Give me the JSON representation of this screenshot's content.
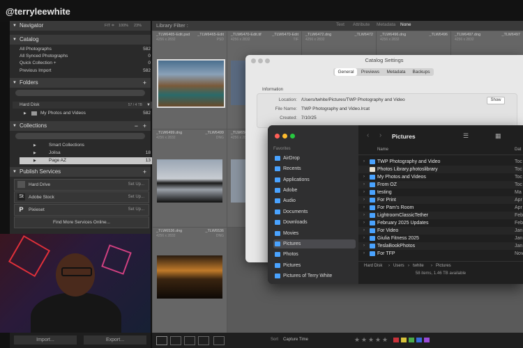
{
  "overlay": {
    "handle": "@terryleewhite"
  },
  "left_panel": {
    "navigator": {
      "label": "Navigator",
      "zoom": [
        "FIT ≑",
        "100%",
        "23%"
      ]
    },
    "catalog": {
      "label": "Catalog",
      "items": [
        {
          "label": "All Photographs",
          "count": "582"
        },
        {
          "label": "All Synced Photographs",
          "count": "0"
        },
        {
          "label": "Quick Collection +",
          "count": "0"
        },
        {
          "label": "Previous Import",
          "count": "582"
        }
      ]
    },
    "folders": {
      "label": "Folders",
      "disk": "Hard Disk",
      "disk_usage": "57 / 4 TB",
      "items": [
        {
          "label": "My Photos and Videos",
          "count": "582"
        }
      ]
    },
    "collections": {
      "label": "Collections",
      "items": [
        {
          "label": "Smart Collections",
          "count": ""
        },
        {
          "label": "Jolisa",
          "count": "18"
        },
        {
          "label": "Page AZ",
          "count": "13"
        }
      ]
    },
    "publish": {
      "label": "Publish Services",
      "items": [
        {
          "label": "Hard Drive",
          "action": "Set Up..."
        },
        {
          "label": "Adobe Stock",
          "action": "Set Up...",
          "icon": "St"
        },
        {
          "label": "Pixieset",
          "action": "Set Up...",
          "icon": "P"
        }
      ],
      "find_more": "Find More Services Online..."
    },
    "import_label": "Import...",
    "export_label": "Export..."
  },
  "library_filter": {
    "label": "Library Filter :",
    "options": [
      "Text",
      "Attribute",
      "Metadata",
      "None"
    ]
  },
  "grid": {
    "cells": [
      {
        "name": "_TLW6465-Edit.psd",
        "dims": "4256 x 2832",
        "fmt": "PSD"
      },
      {
        "name": "_TLW6465-Edit",
        "dims": "4256 x 2832",
        "fmt": "PSD"
      },
      {
        "name": "_TLW6470-Edit.tif",
        "dims": "4256 x 2832",
        "fmt": "TIF"
      },
      {
        "name": "_TLW6470-Edit",
        "dims": "4256 x 2832",
        "fmt": "TIF"
      },
      {
        "name": "_TLW6472.dng",
        "dims": "4256 x 2832",
        "fmt": "DNG"
      },
      {
        "name": "_TLW6472",
        "dims": "4256 x 2832",
        "fmt": "DNG"
      },
      {
        "name": "_TLW6496.dng",
        "dims": "4256 x 2832",
        "fmt": "DNG"
      },
      {
        "name": "_TLW6496",
        "dims": "4256 x 2832",
        "fmt": "DNG"
      },
      {
        "name": "_TLW6497.dng",
        "dims": "4256 x 2832",
        "fmt": "DNG"
      },
      {
        "name": "_TLW6497",
        "dims": "4256 x 2832",
        "fmt": "DNG"
      },
      {
        "name": "_TLW6499.dng",
        "dims": "4256 x 2832",
        "fmt": "DNG"
      },
      {
        "name": "_TLW6499",
        "dims": "4256 x 2832",
        "fmt": "DNG"
      },
      {
        "name": "_TLW650",
        "dims": "4256 x 2832",
        "fmt": ""
      },
      {
        "name": "_TLW6536.dng",
        "dims": "4256 x 2832",
        "fmt": "DNG"
      },
      {
        "name": "_TLW6536",
        "dims": "4256 x 2832",
        "fmt": "DNG"
      }
    ]
  },
  "toolbar": {
    "sort_label": "Sort",
    "sort_value": "Capture Time"
  },
  "catalog_settings": {
    "title": "Catalog Settings",
    "tabs": [
      "General",
      "Previews",
      "Metadata",
      "Backups"
    ],
    "active_tab": "General",
    "section": "Information",
    "location_label": "Location:",
    "location_value": "/Users/twhite/Pictures/TWP Photography and Video",
    "filename_label": "File Name:",
    "filename_value": "TWP Photography and Video.lrcat",
    "created_label": "Created:",
    "created_value": "7/10/25",
    "show_button": "Show"
  },
  "finder": {
    "title": "Pictures",
    "favorites_label": "Favorites",
    "sidebar": [
      {
        "label": "AirDrop",
        "icon": "airdrop-icon"
      },
      {
        "label": "Recents",
        "icon": "clock-icon"
      },
      {
        "label": "Applications",
        "icon": "applications-icon"
      },
      {
        "label": "Adobe",
        "icon": "folder-icon"
      },
      {
        "label": "Audio",
        "icon": "folder-icon"
      },
      {
        "label": "Documents",
        "icon": "folder-icon"
      },
      {
        "label": "Downloads",
        "icon": "download-icon"
      },
      {
        "label": "Movies",
        "icon": "folder-icon"
      },
      {
        "label": "Pictures",
        "icon": "folder-icon",
        "active": true
      },
      {
        "label": "Photos",
        "icon": "folder-icon"
      },
      {
        "label": "Pictures",
        "icon": "folder-icon"
      },
      {
        "label": "Pictures of Terry White",
        "icon": "folder-icon"
      }
    ],
    "column_name": "Name",
    "column_date": "Dat",
    "files": [
      {
        "name": "TWP Photography and Video",
        "date": "Toc"
      },
      {
        "name": "Photos Library.photoslibrary",
        "date": "Toc"
      },
      {
        "name": "My Photos and Videos",
        "date": "Toc"
      },
      {
        "name": "From OZ",
        "date": "Toc"
      },
      {
        "name": "testing",
        "date": "Ma"
      },
      {
        "name": "For Print",
        "date": "Apr"
      },
      {
        "name": "For Pam's Room",
        "date": "Apr"
      },
      {
        "name": "LightroomClassicTether",
        "date": "Feb"
      },
      {
        "name": "February 2025 Updates",
        "date": "Feb"
      },
      {
        "name": "For Video",
        "date": "Jan"
      },
      {
        "name": "Giulia Fitness 2025",
        "date": "Jan"
      },
      {
        "name": "TeslaBookPhotos",
        "date": "Jan"
      },
      {
        "name": "For TFP",
        "date": "Nov"
      }
    ],
    "path": [
      "Hard Disk",
      "Users",
      "twhite",
      "Pictures"
    ],
    "status": "58 items, 1.46 TB available"
  }
}
